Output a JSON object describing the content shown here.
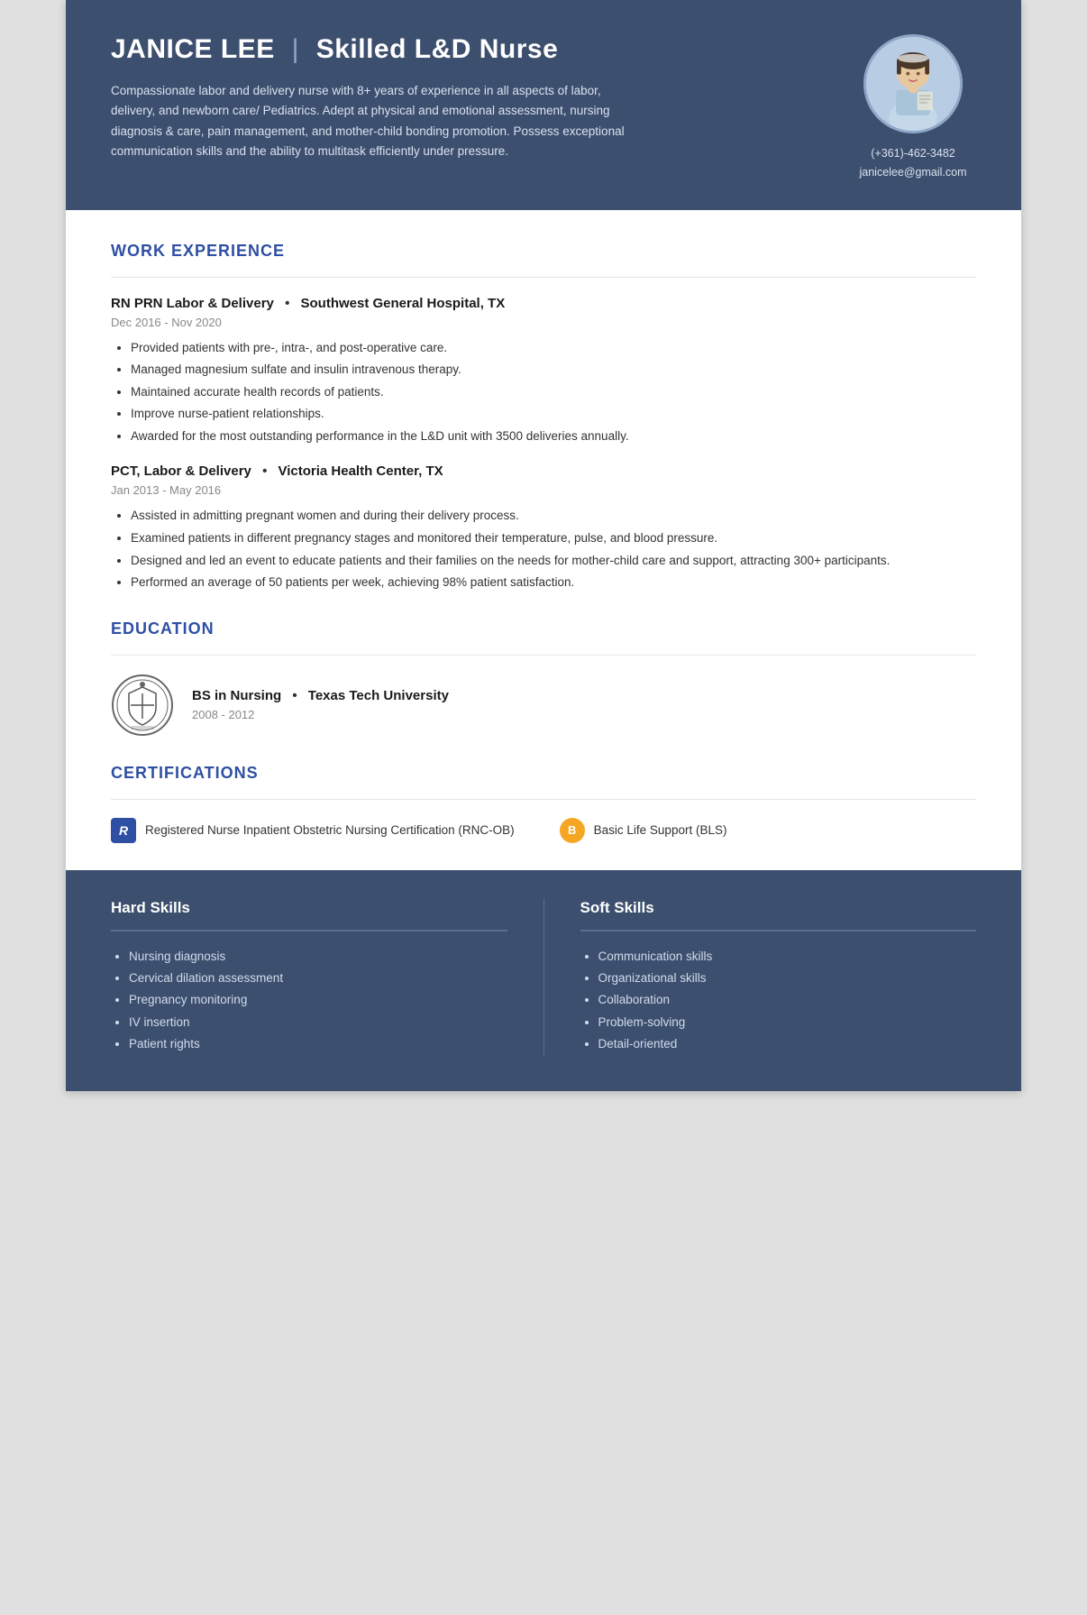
{
  "header": {
    "name": "JANICE LEE",
    "separator": "|",
    "title": "Skilled L&D Nurse",
    "summary": "Compassionate labor and delivery nurse with 8+ years of experience in all aspects of labor, delivery, and newborn care/ Pediatrics. Adept at physical and emotional assessment, nursing diagnosis & care, pain management, and mother-child bonding promotion. Possess exceptional communication skills and the ability to multitask efficiently under pressure.",
    "phone": "(+361)-462-3482",
    "email": "janicelee@gmail.com"
  },
  "sections": {
    "work_experience_title": "WORK EXPERIENCE",
    "education_title": "EDUCATION",
    "certifications_title": "CERTIFICATIONS",
    "hard_skills_title": "Hard Skills",
    "soft_skills_title": "Soft Skills"
  },
  "jobs": [
    {
      "title": "RN PRN Labor & Delivery",
      "company": "Southwest General Hospital, TX",
      "dates": "Dec 2016 - Nov 2020",
      "bullets": [
        "Provided patients with pre-, intra-, and post-operative care.",
        "Managed magnesium sulfate and insulin intravenous therapy.",
        "Maintained accurate health records of patients.",
        "Improve nurse-patient relationships.",
        "Awarded for the most outstanding performance in the L&D unit with 3500 deliveries annually."
      ]
    },
    {
      "title": "PCT, Labor & Delivery",
      "company": "Victoria Health Center, TX",
      "dates": "Jan 2013 - May 2016",
      "bullets": [
        "Assisted in admitting pregnant women and during their delivery process.",
        "Examined patients in different pregnancy stages and monitored their temperature, pulse, and blood pressure.",
        "Designed and led an event to educate patients and their families on the needs for mother-child care and support, attracting 300+ participants.",
        "Performed an average of 50 patients per week, achieving 98% patient satisfaction."
      ]
    }
  ],
  "education": {
    "degree": "BS in Nursing",
    "school": "Texas Tech University",
    "years": "2008 - 2012"
  },
  "certifications": [
    {
      "icon_type": "R",
      "text": "Registered Nurse Inpatient Obstetric Nursing Certification (RNC-OB)"
    },
    {
      "icon_type": "B",
      "text": "Basic Life Support (BLS)"
    }
  ],
  "hard_skills": [
    "Nursing diagnosis",
    "Cervical dilation assessment",
    "Pregnancy monitoring",
    "IV insertion",
    "Patient rights"
  ],
  "soft_skills": [
    "Communication skills",
    "Organizational skills",
    "Collaboration",
    "Problem-solving",
    "Detail-oriented"
  ]
}
